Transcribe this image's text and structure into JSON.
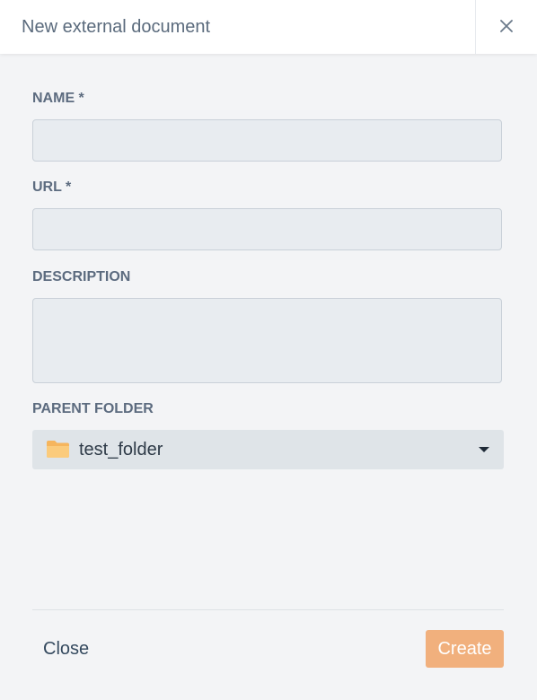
{
  "dialog": {
    "title": "New external document",
    "close_icon": "close-icon"
  },
  "form": {
    "name": {
      "label": "NAME *",
      "value": ""
    },
    "url": {
      "label": "URL *",
      "value": ""
    },
    "description": {
      "label": "DESCRIPTION",
      "value": ""
    },
    "parent_folder": {
      "label": "PARENT FOLDER",
      "selected": "test_folder",
      "icon": "folder-icon"
    }
  },
  "footer": {
    "close_label": "Close",
    "create_label": "Create"
  },
  "colors": {
    "accent_disabled": "#f1b07d",
    "field_bg": "#e8ecf0",
    "label": "#5c6b7f"
  }
}
